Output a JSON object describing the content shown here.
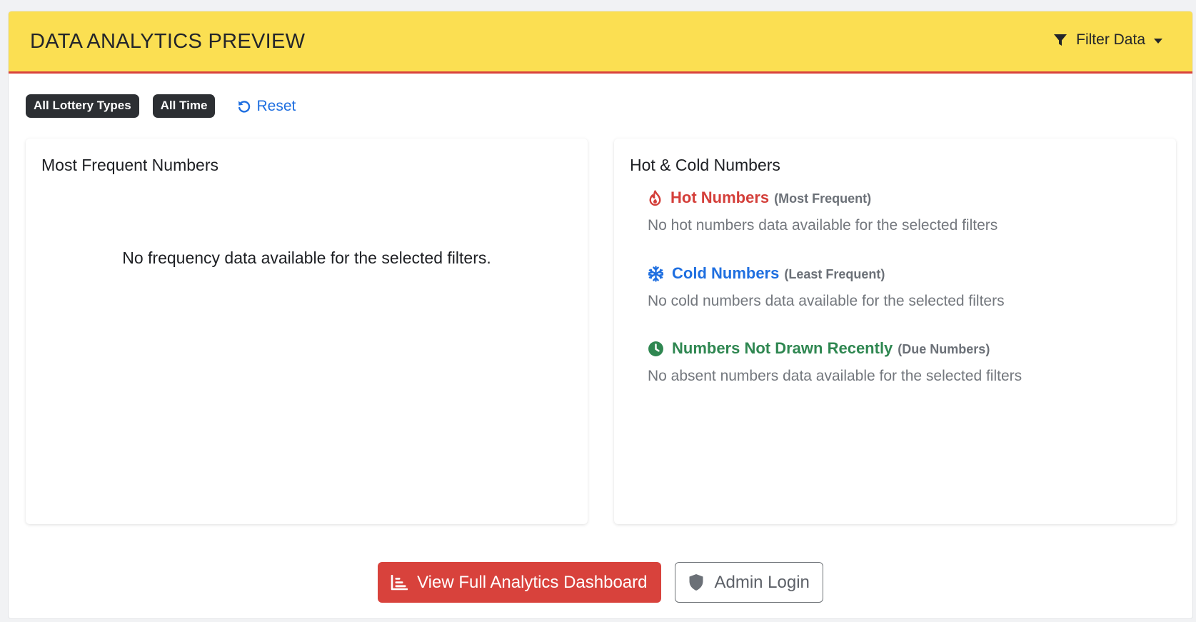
{
  "header": {
    "title": "DATA ANALYTICS PREVIEW",
    "filter_label": "Filter Data"
  },
  "filters": {
    "chips": [
      "All Lottery Types",
      "All Time"
    ],
    "reset_label": "Reset"
  },
  "frequency_panel": {
    "title": "Most Frequent Numbers",
    "empty_message": "No frequency data available for the selected filters."
  },
  "hot_cold_panel": {
    "title": "Hot & Cold Numbers",
    "sections": [
      {
        "heading": "Hot Numbers",
        "subtitle": "(Most Frequent)",
        "message": "No hot numbers data available for the selected filters",
        "icon": "fire-icon",
        "color": "#d43f3a"
      },
      {
        "heading": "Cold Numbers",
        "subtitle": "(Least Frequent)",
        "message": "No cold numbers data available for the selected filters",
        "icon": "snowflake-icon",
        "color": "#1f6fe0"
      },
      {
        "heading": "Numbers Not Drawn Recently",
        "subtitle": "(Due Numbers)",
        "message": "No absent numbers data available for the selected filters",
        "icon": "clock-icon",
        "color": "#2f8751"
      }
    ]
  },
  "actions": {
    "dashboard_label": "View Full Analytics Dashboard",
    "admin_label": "Admin Login"
  },
  "colors": {
    "header_bg": "#fbdf52",
    "accent_red": "#d8423c",
    "link_blue": "#1f6fe0"
  }
}
